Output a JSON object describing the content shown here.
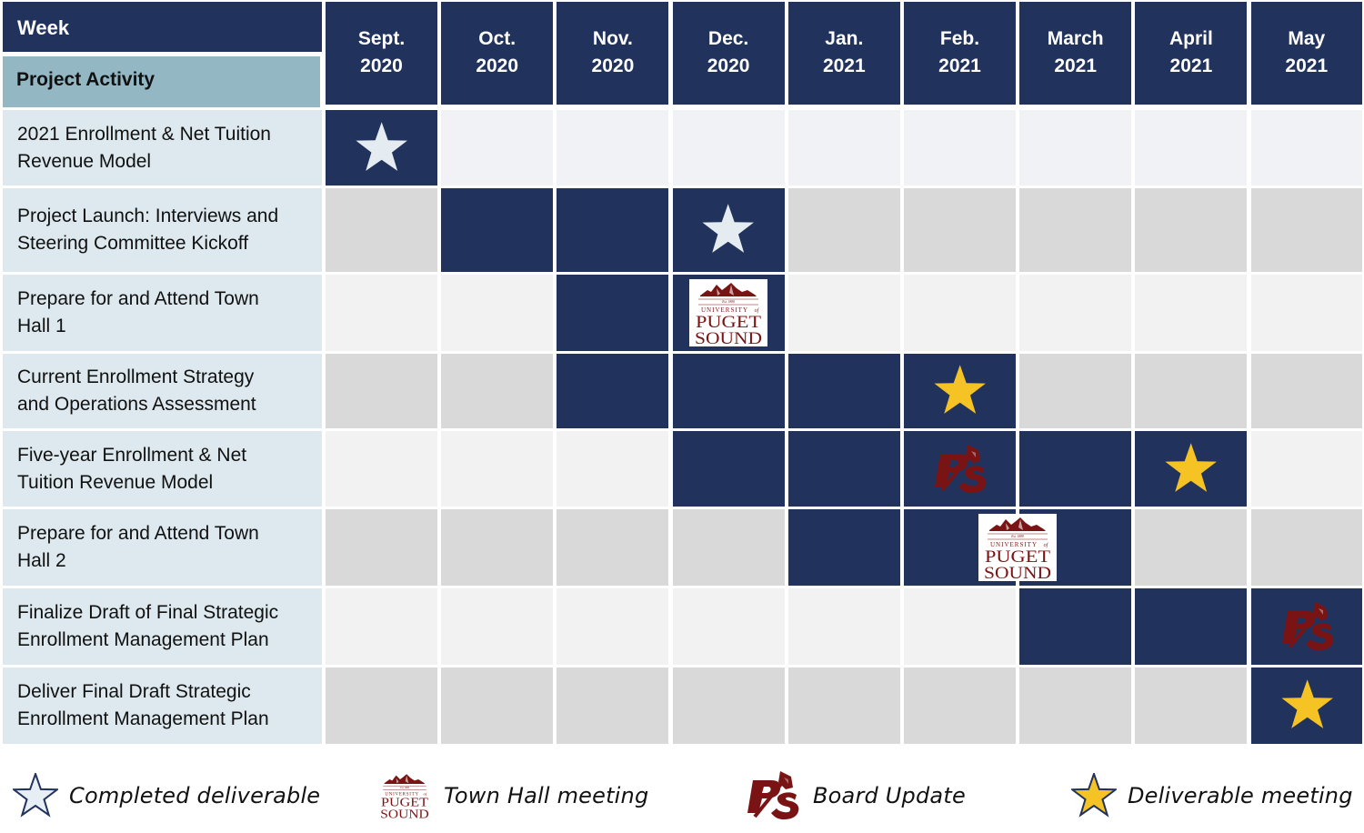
{
  "header": {
    "week_label": "Week",
    "activity_label": "Project Activity",
    "months": [
      {
        "month": "Sept.",
        "year": "2020"
      },
      {
        "month": "Oct.",
        "year": "2020"
      },
      {
        "month": "Nov.",
        "year": "2020"
      },
      {
        "month": "Dec.",
        "year": "2020"
      },
      {
        "month": "Jan.",
        "year": "2021"
      },
      {
        "month": "Feb.",
        "year": "2021"
      },
      {
        "month": "March",
        "year": "2021"
      },
      {
        "month": "April",
        "year": "2021"
      },
      {
        "month": "May",
        "year": "2021"
      }
    ]
  },
  "activities": [
    {
      "line1": "2021 Enrollment & Net Tuition",
      "line2": "Revenue Model",
      "active_months": [
        0
      ],
      "shade": "light-a",
      "markers": [
        {
          "type": "completed-deliverable",
          "month": 0
        }
      ]
    },
    {
      "line1": "Project Launch: Interviews and",
      "line2": "Steering Committee Kickoff",
      "active_months": [
        1,
        2,
        3
      ],
      "shade": "gray",
      "markers": [
        {
          "type": "completed-deliverable",
          "month": 3
        }
      ]
    },
    {
      "line1": "Prepare for and Attend Town",
      "line2": "Hall 1",
      "active_months": [
        2,
        3
      ],
      "shade": "light",
      "markers": [
        {
          "type": "town-hall",
          "month": 3
        }
      ]
    },
    {
      "line1": "Current Enrollment Strategy",
      "line2": "and Operations Assessment",
      "active_months": [
        2,
        3,
        4,
        5
      ],
      "shade": "gray",
      "markers": [
        {
          "type": "deliverable-meeting",
          "month": 5
        }
      ]
    },
    {
      "line1": "Five-year Enrollment & Net",
      "line2": "Tuition Revenue Model",
      "active_months": [
        3,
        4,
        5,
        6,
        7
      ],
      "shade": "light",
      "markers": [
        {
          "type": "board-update",
          "month": 5
        },
        {
          "type": "deliverable-meeting",
          "month": 7
        }
      ]
    },
    {
      "line1": "Prepare for and Attend Town",
      "line2": "Hall 2",
      "active_months": [
        4,
        5,
        6
      ],
      "shade": "gray",
      "markers": [
        {
          "type": "town-hall",
          "month": 5.5
        }
      ]
    },
    {
      "line1": "Finalize Draft of Final Strategic",
      "line2": "Enrollment Management Plan",
      "active_months": [
        6,
        7,
        8
      ],
      "shade": "light",
      "markers": [
        {
          "type": "board-update",
          "month": 8
        }
      ]
    },
    {
      "line1": "Deliver Final Draft Strategic",
      "line2": "Enrollment Management Plan",
      "active_months": [
        8
      ],
      "shade": "gray",
      "markers": [
        {
          "type": "deliverable-meeting",
          "month": 8
        }
      ]
    }
  ],
  "legend": [
    {
      "type": "completed-deliverable",
      "label": "Completed deliverable"
    },
    {
      "type": "town-hall",
      "label": "Town Hall meeting"
    },
    {
      "type": "board-update",
      "label": "Board Update"
    },
    {
      "type": "deliverable-meeting",
      "label": "Deliverable meeting"
    }
  ],
  "logo_text": {
    "est": "Est. 1888",
    "university": "UNIVERSITY",
    "of": "of",
    "puget": "PUGET",
    "sound": "SOUND",
    "monogram": "PS"
  },
  "colors": {
    "navy": "#21325c",
    "completed_star": "#e4ecf1",
    "deliverable_star": "#f6c324",
    "maroon": "#7a1414"
  }
}
